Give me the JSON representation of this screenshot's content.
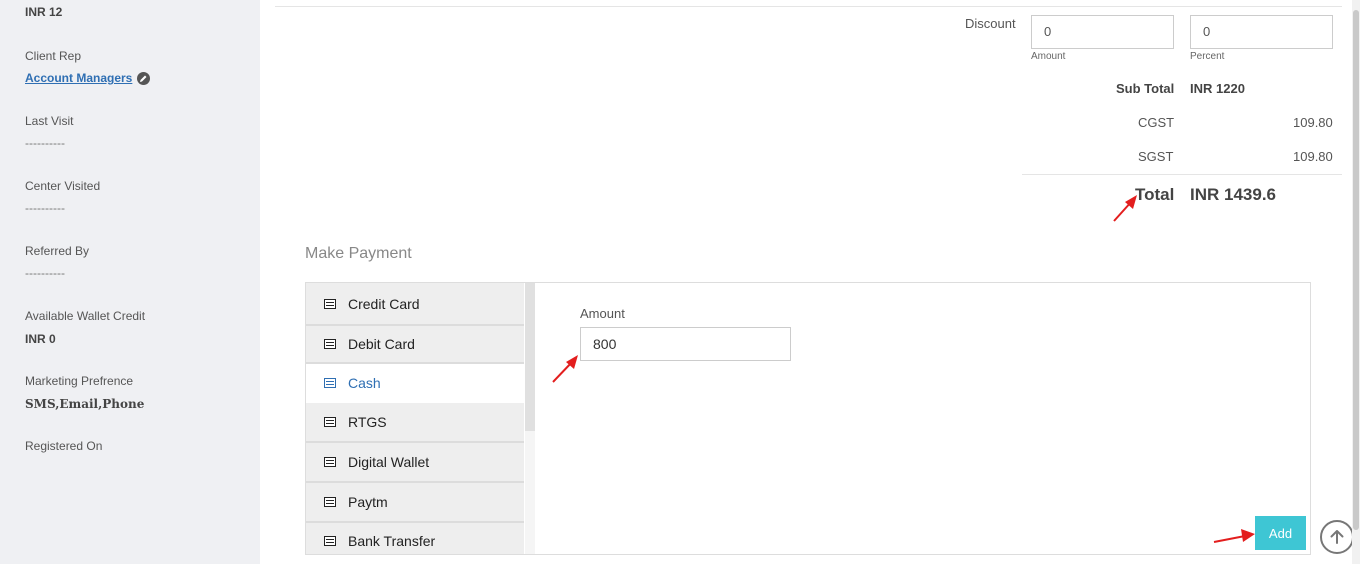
{
  "sidebar": {
    "balance_value": "INR 12",
    "client_rep_label": "Client Rep",
    "client_rep_link": "Account Managers",
    "last_visit_label": "Last Visit",
    "last_visit_value": "----------",
    "center_visited_label": "Center Visited",
    "center_visited_value": "----------",
    "referred_by_label": "Referred By",
    "referred_by_value": "----------",
    "wallet_label": "Available Wallet Credit",
    "wallet_value": "INR 0",
    "marketing_label": "Marketing Prefrence",
    "marketing_value": "SMS,Email,Phone",
    "registered_label": "Registered On"
  },
  "totals": {
    "discount_label": "Discount",
    "discount_amount_value": "0",
    "discount_amount_caption": "Amount",
    "discount_percent_value": "0",
    "discount_percent_caption": "Percent",
    "subtotal_label": "Sub Total",
    "subtotal_value": "INR 1220",
    "cgst_label": "CGST",
    "cgst_value": "109.80",
    "sgst_label": "SGST",
    "sgst_value": "109.80",
    "total_label": "Total",
    "total_value": "INR 1439.6"
  },
  "payment": {
    "section_title": "Make Payment",
    "methods": [
      {
        "label": "Credit Card",
        "active": false
      },
      {
        "label": "Debit Card",
        "active": false
      },
      {
        "label": "Cash",
        "active": true
      },
      {
        "label": "RTGS",
        "active": false
      },
      {
        "label": "Digital Wallet",
        "active": false
      },
      {
        "label": "Paytm",
        "active": false
      },
      {
        "label": "Bank Transfer",
        "active": false
      }
    ],
    "amount_label": "Amount",
    "amount_value": "800",
    "add_button": "Add"
  },
  "colors": {
    "sidebar_bg": "#eff0f3",
    "link": "#2f6fb3",
    "add_button": "#3ec6d4",
    "annotation_arrow": "#e31e1e"
  },
  "icons": [
    "edit-icon",
    "card-icon",
    "scroll-up-icon"
  ]
}
